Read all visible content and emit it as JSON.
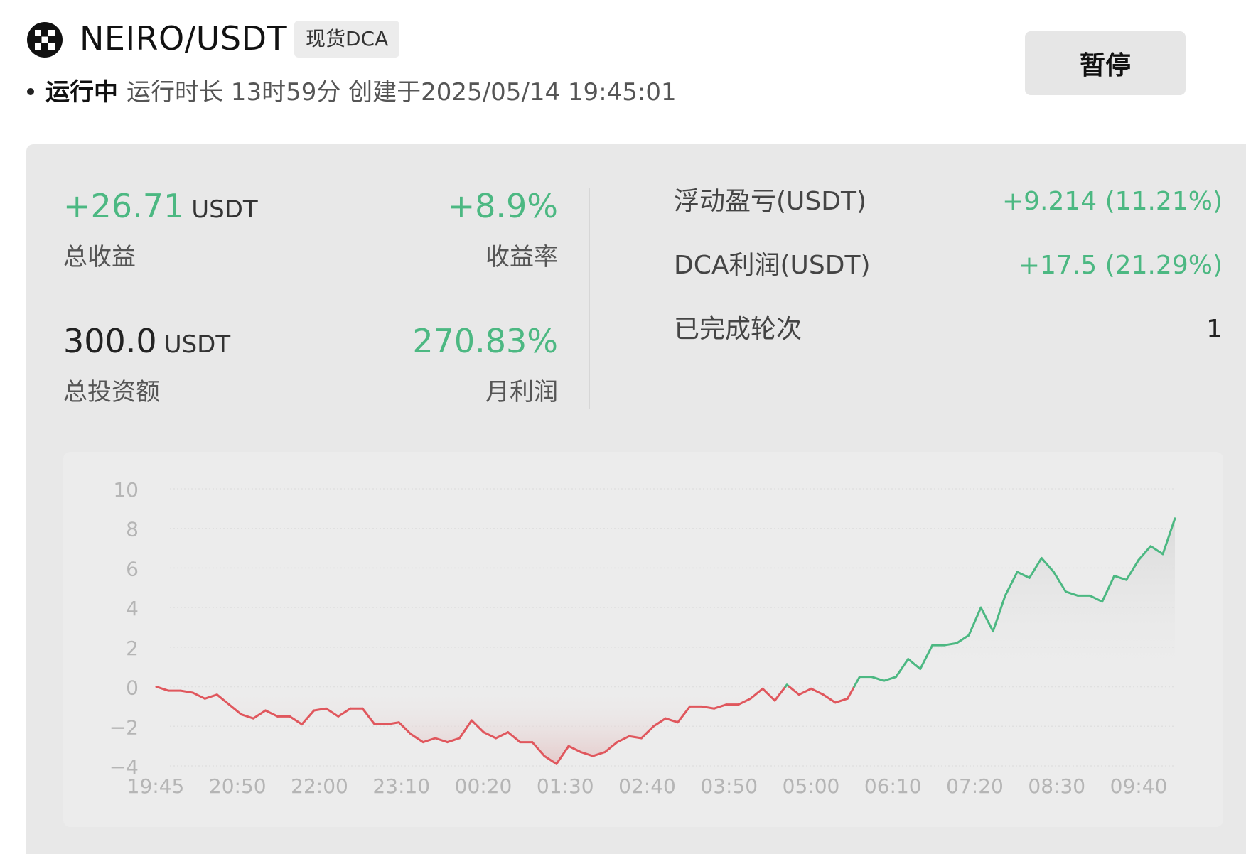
{
  "header": {
    "pair": "NEIRO/USDT",
    "tag": "现货DCA",
    "status": "运行中",
    "runtime": "运行时长 13时59分",
    "created": "创建于2025/05/14 19:45:01",
    "pause_label": "暂停",
    "logo_icon": "okx-logo-icon"
  },
  "stats": {
    "total_profit_value": "+26.71",
    "total_profit_unit": "USDT",
    "total_profit_label": "总收益",
    "profit_rate_value": "+8.9%",
    "profit_rate_label": "收益率",
    "total_invest_value": "300.0",
    "total_invest_unit": "USDT",
    "total_invest_label": "总投资额",
    "monthly_profit_value": "270.83%",
    "monthly_profit_label": "月利润"
  },
  "details": {
    "floating_label": "浮动盈亏(USDT)",
    "floating_value": "+9.214 (11.21%)",
    "dca_label": "DCA利润(USDT)",
    "dca_value": "+17.5 (21.29%)",
    "rounds_label": "已完成轮次",
    "rounds_value": "1"
  },
  "colors": {
    "positive": "#4cb882",
    "negative": "#e0575d",
    "panel_bg": "#e8e8e8"
  },
  "chart_data": {
    "type": "line",
    "ylim": [
      -4,
      10
    ],
    "yticks": [
      "10",
      "8",
      "6",
      "4",
      "2",
      "0",
      "−2",
      "−4"
    ],
    "ytick_values": [
      10,
      8,
      6,
      4,
      2,
      0,
      -2,
      -4
    ],
    "xticks": [
      "19:45",
      "20:50",
      "22:00",
      "23:10",
      "00:20",
      "01:30",
      "02:40",
      "03:50",
      "05:00",
      "06:10",
      "07:20",
      "08:30",
      "09:40"
    ],
    "grid": true,
    "series": [
      {
        "values": [
          0.0,
          -0.2,
          -0.2,
          -0.3,
          -0.6,
          -0.4,
          -0.9,
          -1.4,
          -1.6,
          -1.2,
          -1.5,
          -1.5,
          -1.9,
          -1.2,
          -1.1,
          -1.5,
          -1.1,
          -1.1,
          -1.9,
          -1.9,
          -1.8,
          -2.4,
          -2.8,
          -2.6,
          -2.8,
          -2.6,
          -1.7,
          -2.3,
          -2.6,
          -2.3,
          -2.8,
          -2.8,
          -3.5,
          -3.9,
          -3.0,
          -3.3,
          -3.5,
          -3.3,
          -2.8,
          -2.5,
          -2.6,
          -2.0,
          -1.6,
          -1.8,
          -1.0,
          -1.0,
          -1.1,
          -0.9,
          -0.9,
          -0.6,
          -0.1,
          -0.7,
          0.1,
          -0.4,
          -0.1,
          -0.4,
          -0.8,
          -0.6,
          0.5,
          0.5,
          0.3,
          0.5,
          1.4,
          0.9,
          2.1,
          2.1,
          2.2,
          2.6,
          4.0,
          2.8,
          4.6,
          5.8,
          5.5,
          6.5,
          5.8,
          4.8,
          4.6,
          4.6,
          4.3,
          5.6,
          5.4,
          6.4,
          7.1,
          6.7,
          8.5
        ]
      }
    ]
  }
}
